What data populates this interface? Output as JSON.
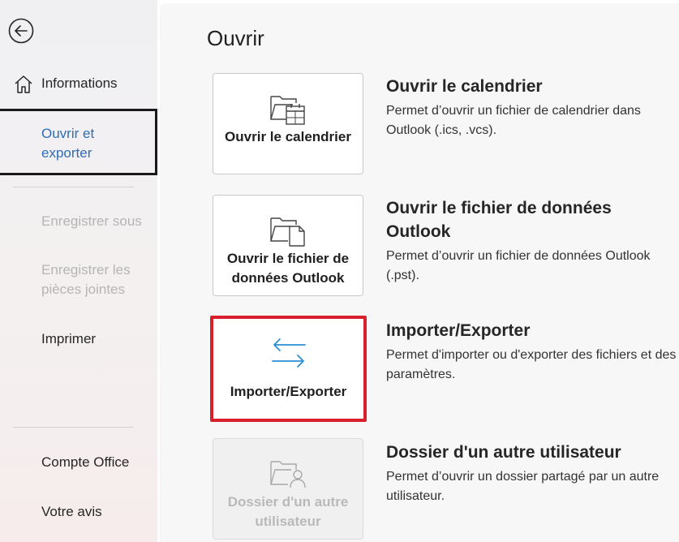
{
  "sidebar": {
    "items": [
      {
        "label": "Informations"
      },
      {
        "label": "Ouvrir et exporter"
      },
      {
        "label": "Enregistrer sous"
      },
      {
        "label": "Enregistrer les pièces jointes"
      },
      {
        "label": "Imprimer"
      },
      {
        "label": "Compte Office"
      },
      {
        "label": "Votre avis"
      }
    ]
  },
  "main": {
    "title": "Ouvrir",
    "options": [
      {
        "tile_label": "Ouvrir le calendrier",
        "title": "Ouvrir le calendrier",
        "description": "Permet d’ouvrir un fichier de calendrier dans Outlook (.ics, .vcs).",
        "icon": "folder-calendar-icon"
      },
      {
        "tile_label": "Ouvrir le fichier de données Outlook",
        "title": "Ouvrir le fichier de données Outlook",
        "description": "Permet d’ouvrir un fichier de données Outlook (.pst).",
        "icon": "folder-file-icon"
      },
      {
        "tile_label": "Importer/Exporter",
        "title": "Importer/Exporter",
        "description": "Permet d'importer ou d'exporter des fichiers et des paramètres.",
        "icon": "import-export-arrows-icon"
      },
      {
        "tile_label": "Dossier d'un autre utilisateur",
        "title": "Dossier d'un autre utilisateur",
        "description": "Permet d’ouvrir un dossier partagé par un autre utilisateur.",
        "icon": "shared-folder-user-icon"
      }
    ]
  },
  "colors": {
    "accent": "#2f6db5",
    "highlight": "#d8202c",
    "icon_blue": "#2b8fd6"
  }
}
